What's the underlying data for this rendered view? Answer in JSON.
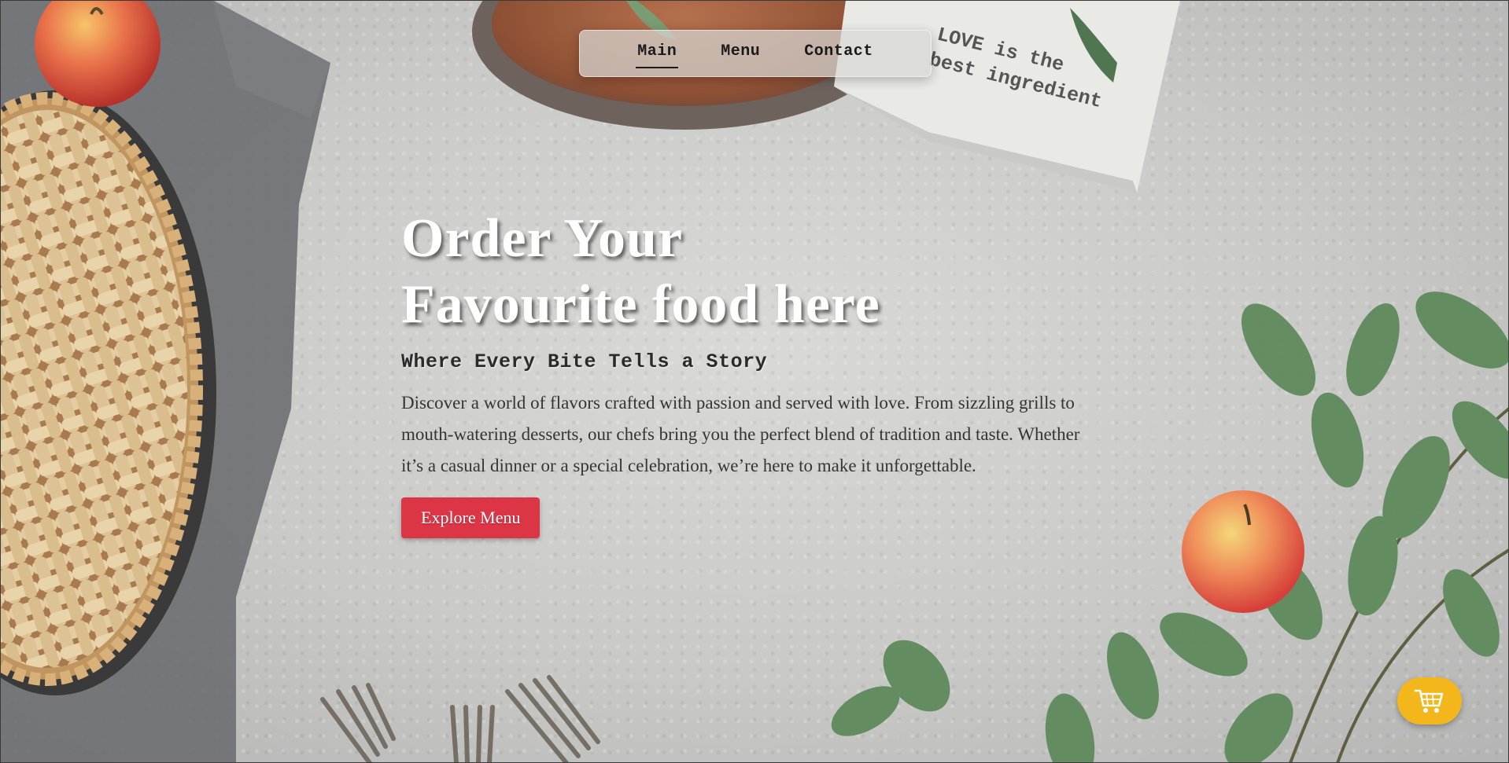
{
  "nav": {
    "items": [
      {
        "label": "Main",
        "active": true
      },
      {
        "label": "Menu",
        "active": false
      },
      {
        "label": "Contact",
        "active": false
      }
    ]
  },
  "hero": {
    "title_line1": "Order Your",
    "title_line2": "Favourite food here",
    "subtitle": "Where Every Bite Tells a Story",
    "description": "Discover a world of flavors crafted with passion and served with love. From sizzling grills to mouth-watering desserts, our chefs bring you the perfect blend of tradition and taste. Whether it’s a casual dinner or a special celebration, we’re here to make it unforgettable.",
    "cta_label": "Explore Menu"
  },
  "background": {
    "napkin_text_line1": "LOVE is the",
    "napkin_text_line2": "best ingredient"
  },
  "cart": {
    "icon": "cart-icon"
  },
  "colors": {
    "accent": "#dc3545",
    "cart_button": "#f3b71b",
    "title": "#ffffff"
  }
}
